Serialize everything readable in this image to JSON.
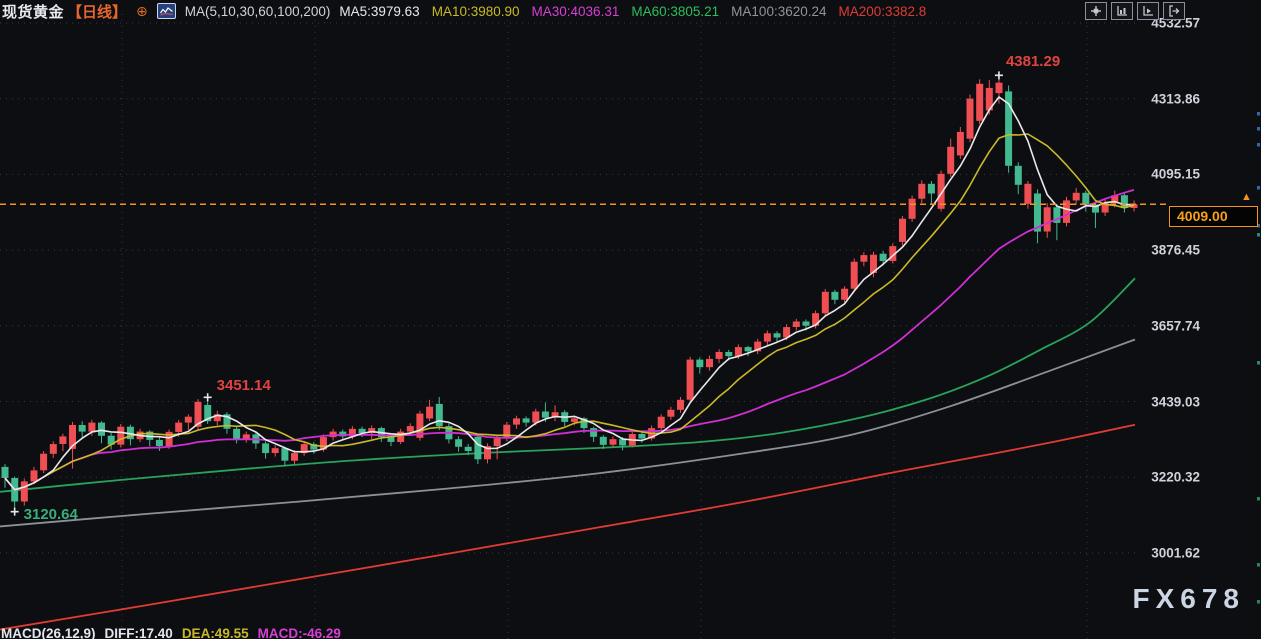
{
  "header": {
    "symbol": "现货黄金",
    "timeframe": "【日线】",
    "ma_settings": "MA(5,10,30,60,100,200)",
    "ma_values": [
      {
        "label": "MA5:3979.63",
        "color": "#e9e9ec"
      },
      {
        "label": "MA10:3980.90",
        "color": "#c9b928"
      },
      {
        "label": "MA30:4036.31",
        "color": "#d63fd6"
      },
      {
        "label": "MA60:3805.21",
        "color": "#2ebd5b"
      },
      {
        "label": "MA100:3620.24",
        "color": "#8f939c"
      },
      {
        "label": "MA200:3382.8",
        "color": "#de3b36"
      }
    ],
    "toolbar": [
      {
        "icon": "pan-tool-icon"
      },
      {
        "icon": "left-scale-tool-icon"
      },
      {
        "icon": "right-scale-tool-icon"
      },
      {
        "icon": "detach-pane-tool-icon"
      }
    ]
  },
  "y_axis": {
    "ticks": [
      "4532.57",
      "4313.86",
      "4095.15",
      "3876.45",
      "3657.74",
      "3439.03",
      "3220.32",
      "3001.62"
    ]
  },
  "price_marker": {
    "value": "4009.00",
    "arrow": "▲",
    "color": "#f7931a"
  },
  "watermark": "FX678",
  "footer": {
    "macd_label": "MACD(26,12,9)",
    "diff": "DIFF:17.40",
    "dea": "DEA:49.55",
    "macd": "MACD:-46.29",
    "diff_color": "#e2e6ee",
    "dea_color": "#c9b928",
    "macd_color": "#d63fd6"
  },
  "chart_data": {
    "type": "candlestick",
    "title": "现货黄金 日线 (Spot Gold, daily)",
    "up_color": "#ef4f53",
    "down_color": "#42b98e",
    "current_price": 4009.0,
    "y_range": {
      "top": 4532.57,
      "bottom": 3001.62
    },
    "candles_ohlc": [
      [
        3250,
        3258,
        3190,
        3218
      ],
      [
        3218,
        3222,
        3120.64,
        3150
      ],
      [
        3150,
        3216,
        3138,
        3208
      ],
      [
        3208,
        3250,
        3200,
        3240
      ],
      [
        3240,
        3296,
        3232,
        3288
      ],
      [
        3288,
        3324,
        3276,
        3316
      ],
      [
        3316,
        3346,
        3295,
        3338
      ],
      [
        3302,
        3380,
        3245,
        3371
      ],
      [
        3371,
        3382,
        3335,
        3352
      ],
      [
        3352,
        3386,
        3340,
        3378
      ],
      [
        3378,
        3382,
        3318,
        3340
      ],
      [
        3340,
        3348,
        3300,
        3314
      ],
      [
        3314,
        3374,
        3306,
        3366
      ],
      [
        3366,
        3372,
        3312,
        3330
      ],
      [
        3330,
        3360,
        3322,
        3352
      ],
      [
        3352,
        3356,
        3310,
        3328
      ],
      [
        3328,
        3336,
        3296,
        3310
      ],
      [
        3310,
        3358,
        3302,
        3351
      ],
      [
        3351,
        3386,
        3337,
        3378
      ],
      [
        3378,
        3402,
        3357,
        3395
      ],
      [
        3366,
        3446,
        3358,
        3438
      ],
      [
        3429,
        3451.14,
        3374,
        3382
      ],
      [
        3382,
        3412,
        3370,
        3402
      ],
      [
        3402,
        3408,
        3346,
        3360
      ],
      [
        3360,
        3366,
        3318,
        3330
      ],
      [
        3330,
        3352,
        3320,
        3344
      ],
      [
        3344,
        3350,
        3302,
        3318
      ],
      [
        3318,
        3324,
        3274,
        3290
      ],
      [
        3290,
        3312,
        3280,
        3304
      ],
      [
        3304,
        3308,
        3252,
        3268
      ],
      [
        3268,
        3298,
        3258,
        3290
      ],
      [
        3290,
        3324,
        3282,
        3316
      ],
      [
        3316,
        3322,
        3288,
        3300
      ],
      [
        3300,
        3344,
        3294,
        3336
      ],
      [
        3336,
        3360,
        3326,
        3352
      ],
      [
        3352,
        3358,
        3326,
        3338
      ],
      [
        3338,
        3368,
        3330,
        3360
      ],
      [
        3360,
        3366,
        3336,
        3348
      ],
      [
        3348,
        3370,
        3330,
        3362
      ],
      [
        3362,
        3366,
        3322,
        3336
      ],
      [
        3336,
        3342,
        3310,
        3322
      ],
      [
        3322,
        3360,
        3316,
        3352
      ],
      [
        3352,
        3376,
        3344,
        3368
      ],
      [
        3334,
        3412,
        3326,
        3404
      ],
      [
        3390,
        3444,
        3382,
        3424
      ],
      [
        3432,
        3452,
        3356,
        3368
      ],
      [
        3368,
        3376,
        3318,
        3330
      ],
      [
        3330,
        3338,
        3294,
        3308
      ],
      [
        3308,
        3316,
        3284,
        3296
      ],
      [
        3337,
        3342,
        3258,
        3272
      ],
      [
        3272,
        3318,
        3260,
        3310
      ],
      [
        3310,
        3340,
        3272,
        3332
      ],
      [
        3332,
        3380,
        3324,
        3372
      ],
      [
        3372,
        3398,
        3360,
        3390
      ],
      [
        3390,
        3396,
        3366,
        3378
      ],
      [
        3378,
        3418,
        3370,
        3410
      ],
      [
        3410,
        3436,
        3380,
        3392
      ],
      [
        3392,
        3428,
        3382,
        3408
      ],
      [
        3408,
        3414,
        3368,
        3380
      ],
      [
        3380,
        3398,
        3370,
        3390
      ],
      [
        3390,
        3394,
        3348,
        3362
      ],
      [
        3362,
        3366,
        3322,
        3337
      ],
      [
        3337,
        3342,
        3302,
        3314
      ],
      [
        3314,
        3338,
        3306,
        3330
      ],
      [
        3330,
        3336,
        3298,
        3312
      ],
      [
        3312,
        3352,
        3306,
        3345
      ],
      [
        3345,
        3350,
        3320,
        3332
      ],
      [
        3332,
        3370,
        3326,
        3362
      ],
      [
        3362,
        3402,
        3354,
        3395
      ],
      [
        3395,
        3424,
        3386,
        3415
      ],
      [
        3415,
        3452,
        3406,
        3444
      ],
      [
        3444,
        3568,
        3438,
        3560
      ],
      [
        3560,
        3566,
        3520,
        3538
      ],
      [
        3538,
        3572,
        3528,
        3562
      ],
      [
        3562,
        3590,
        3550,
        3582
      ],
      [
        3582,
        3588,
        3558,
        3570
      ],
      [
        3570,
        3604,
        3562,
        3596
      ],
      [
        3596,
        3600,
        3570,
        3584
      ],
      [
        3584,
        3620,
        3576,
        3612
      ],
      [
        3612,
        3644,
        3602,
        3636
      ],
      [
        3636,
        3642,
        3610,
        3624
      ],
      [
        3624,
        3662,
        3616,
        3654
      ],
      [
        3654,
        3678,
        3644,
        3670
      ],
      [
        3670,
        3676,
        3644,
        3658
      ],
      [
        3658,
        3702,
        3650,
        3694
      ],
      [
        3694,
        3764,
        3686,
        3756
      ],
      [
        3756,
        3762,
        3720,
        3733
      ],
      [
        3733,
        3772,
        3724,
        3765
      ],
      [
        3765,
        3852,
        3758,
        3843
      ],
      [
        3843,
        3870,
        3830,
        3862
      ],
      [
        3810,
        3872,
        3798,
        3863
      ],
      [
        3866,
        3874,
        3832,
        3845
      ],
      [
        3845,
        3896,
        3838,
        3888
      ],
      [
        3900,
        3975,
        3890,
        3967
      ],
      [
        3967,
        4034,
        3958,
        4025
      ],
      [
        4025,
        4078,
        4012,
        4068
      ],
      [
        4068,
        4076,
        4008,
        4040
      ],
      [
        3996,
        4106,
        3988,
        4097
      ],
      [
        4097,
        4198,
        4088,
        4175
      ],
      [
        4150,
        4232,
        4140,
        4218
      ],
      [
        4198,
        4326,
        4188,
        4314
      ],
      [
        4250,
        4370,
        4240,
        4357
      ],
      [
        4280,
        4368,
        4268,
        4345
      ],
      [
        4330,
        4381.29,
        4300,
        4360
      ],
      [
        4335,
        4352,
        4100,
        4120
      ],
      [
        4120,
        4130,
        4038,
        4065
      ],
      [
        4010,
        4076,
        3996,
        4068
      ],
      [
        4040,
        4052,
        3896,
        3930
      ],
      [
        3930,
        4012,
        3912,
        4000
      ],
      [
        4000,
        4010,
        3905,
        3955
      ],
      [
        3955,
        4030,
        3945,
        4020
      ],
      [
        4020,
        4056,
        4008,
        4042
      ],
      [
        4042,
        4048,
        3988,
        4008
      ],
      [
        4008,
        4016,
        3940,
        3985
      ],
      [
        3985,
        4022,
        3975,
        4012
      ],
      [
        4012,
        4048,
        4000,
        4035
      ],
      [
        4035,
        4042,
        3985,
        3998
      ],
      [
        3998,
        4020,
        3988,
        4009
      ]
    ],
    "ma_computed": [
      {
        "name": "MA30",
        "window": 30,
        "color": "#cf2fd4",
        "width": 1.8
      },
      {
        "name": "MA10",
        "window": 10,
        "color": "#c9b928",
        "width": 1.6
      },
      {
        "name": "MA5",
        "window": 5,
        "color": "#e9e9ec",
        "width": 1.6
      }
    ],
    "ma_anchored": [
      {
        "name": "MA200",
        "color": "#e23b33",
        "width": 1.8,
        "points": [
          [
            0,
            2780
          ],
          [
            150,
            2852
          ],
          [
            300,
            2926
          ],
          [
            450,
            3000
          ],
          [
            600,
            3076
          ],
          [
            750,
            3152
          ],
          [
            900,
            3238
          ],
          [
            1000,
            3292
          ],
          [
            1070,
            3332
          ],
          [
            1135,
            3372
          ]
        ]
      },
      {
        "name": "MA100",
        "color": "#8b9099",
        "width": 1.8,
        "points": [
          [
            0,
            3078
          ],
          [
            150,
            3115
          ],
          [
            300,
            3150
          ],
          [
            450,
            3188
          ],
          [
            600,
            3232
          ],
          [
            750,
            3292
          ],
          [
            850,
            3342
          ],
          [
            950,
            3425
          ],
          [
            1050,
            3528
          ],
          [
            1135,
            3618
          ]
        ]
      },
      {
        "name": "MA60",
        "color": "#27a35b",
        "width": 1.8,
        "points": [
          [
            0,
            3178
          ],
          [
            120,
            3212
          ],
          [
            240,
            3243
          ],
          [
            360,
            3270
          ],
          [
            480,
            3290
          ],
          [
            600,
            3305
          ],
          [
            700,
            3322
          ],
          [
            780,
            3348
          ],
          [
            860,
            3392
          ],
          [
            930,
            3448
          ],
          [
            990,
            3515
          ],
          [
            1040,
            3588
          ],
          [
            1090,
            3668
          ],
          [
            1135,
            3795
          ]
        ]
      }
    ],
    "annotations": [
      {
        "label": "4381.29",
        "index": 103,
        "price": 4381.29,
        "color": "#e04440",
        "dx": 7,
        "dy": -22
      },
      {
        "label": "3451.14",
        "index": 21,
        "price": 3451.14,
        "color": "#e04440",
        "dx": 9,
        "dy": -20
      },
      {
        "label": "3120.64",
        "index": 1,
        "price": 3120.64,
        "color": "#3aae79",
        "dx": 9,
        "dy": -6
      }
    ],
    "right_edge_marks": [
      {
        "y": 112,
        "color": "#3f74c9"
      },
      {
        "y": 127,
        "color": "#3f74c9"
      },
      {
        "y": 143,
        "color": "#3f74c9"
      },
      {
        "y": 186,
        "color": "#3f74c9"
      },
      {
        "y": 224,
        "color": "#3f74c9"
      },
      {
        "y": 233,
        "color": "#2e9e8f"
      },
      {
        "y": 361,
        "color": "#2e9e8f"
      },
      {
        "y": 497,
        "color": "#2f9e5d"
      },
      {
        "y": 563,
        "color": "#2f9e5d"
      },
      {
        "y": 600,
        "color": "#2f9e5d"
      }
    ]
  }
}
